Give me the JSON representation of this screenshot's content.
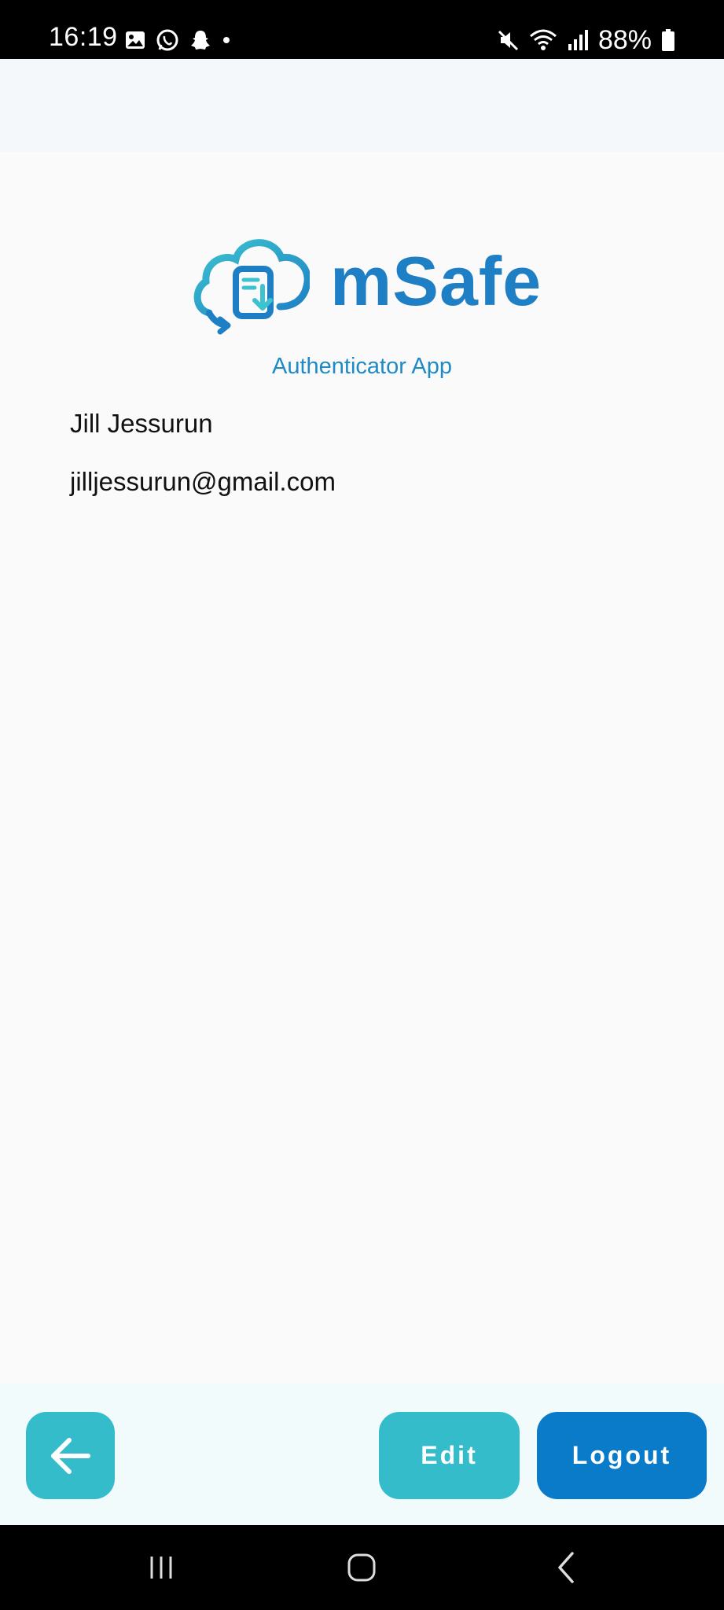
{
  "status_bar": {
    "time": "16:19",
    "battery": "88%",
    "left_icons": [
      "gallery-icon",
      "whatsapp-icon",
      "snapchat-icon",
      "dot-icon"
    ],
    "right_icons": [
      "mute-icon",
      "wifi-icon",
      "signal-icon",
      "battery-icon"
    ]
  },
  "logo": {
    "name": "mSafe",
    "subtitle": "Authenticator App",
    "brand_color": "#1f7fc4",
    "accent_color": "#34bccb"
  },
  "user": {
    "name": "Jill Jessurun",
    "email": "jilljessurun@gmail.com"
  },
  "actions": {
    "back_icon": "arrow-left-icon",
    "edit_label": "Edit",
    "logout_label": "Logout",
    "edit_color": "#34bccb",
    "logout_color": "#0a7bc9"
  },
  "nav": {
    "items": [
      "recent-apps-icon",
      "home-icon",
      "back-icon"
    ]
  }
}
